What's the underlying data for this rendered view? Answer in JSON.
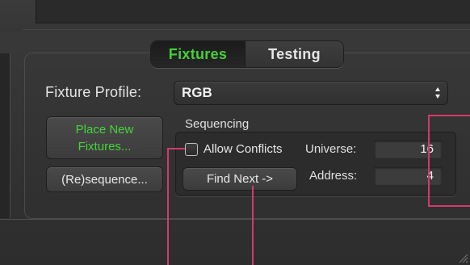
{
  "tabs": [
    {
      "label": "Fixtures",
      "active": true
    },
    {
      "label": "Testing",
      "active": false
    }
  ],
  "fixture_profile": {
    "label": "Fixture Profile:",
    "selected": "RGB"
  },
  "buttons": {
    "place_new_line1": "Place New",
    "place_new_line2": "Fixtures...",
    "resequence": "(Re)sequence...",
    "find_next": "Find Next ->"
  },
  "sequencing": {
    "title": "Sequencing",
    "allow_conflicts_label": "Allow Conflicts",
    "allow_conflicts_checked": false,
    "universe_label": "Universe:",
    "universe_value": "16",
    "address_label": "Address:",
    "address_value": "4"
  },
  "colors": {
    "accent_green": "#45d13a",
    "annotation_pink": "#d43a6a"
  },
  "icons": [
    "updown-arrows-icon",
    "checkbox-icon",
    "resize-grip-icon"
  ]
}
